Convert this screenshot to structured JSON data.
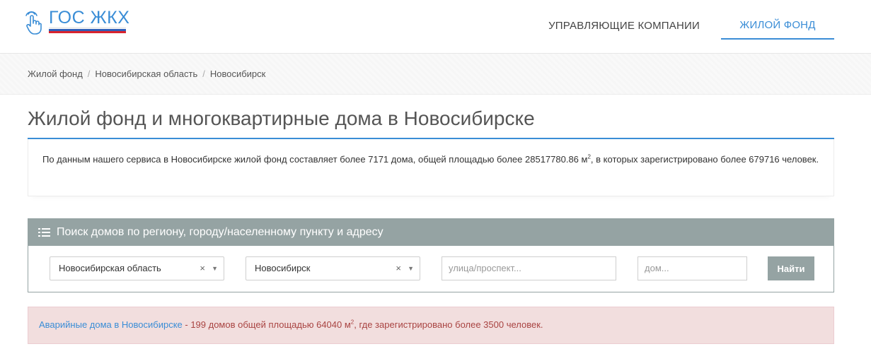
{
  "header": {
    "logo_text": "ГОС ЖКХ",
    "nav": [
      {
        "label": "УПРАВЛЯЮЩИЕ КОМПАНИИ",
        "active": false
      },
      {
        "label": "ЖИЛОЙ ФОНД",
        "active": true
      }
    ],
    "accent_color": "#3a8dd6"
  },
  "breadcrumb": [
    "Жилой фонд",
    "Новосибирская область",
    "Новосибирск"
  ],
  "page_title": "Жилой фонд и многоквартирные дома в Новосибирске",
  "info": {
    "text_before_sup": "По данным нашего сервиса в Новосибирске жилой фонд составляет более 7171 дома, общей площадью более 28517780.86 м",
    "sup": "2",
    "text_after_sup": ", в которых зарегистрировано более 679716 человек."
  },
  "search": {
    "title": "Поиск домов по региону, городу/населенному пункту и адресу",
    "region_value": "Новосибирская область",
    "city_value": "Новосибирск",
    "clear_glyph": "×",
    "arrow_glyph": "▼",
    "street_placeholder": "улица/проспект...",
    "house_placeholder": "дом...",
    "submit_label": "Найти",
    "panel_color": "#95a3a3"
  },
  "alert": {
    "link_text": "Аварийные дома в Новосибирске",
    "text_before_sup": " - 199 домов общей площадью 64040 м",
    "sup": "2",
    "text_after_sup": ", где зарегистрировано более 3500 человек.",
    "bg_color": "#f2dede"
  }
}
